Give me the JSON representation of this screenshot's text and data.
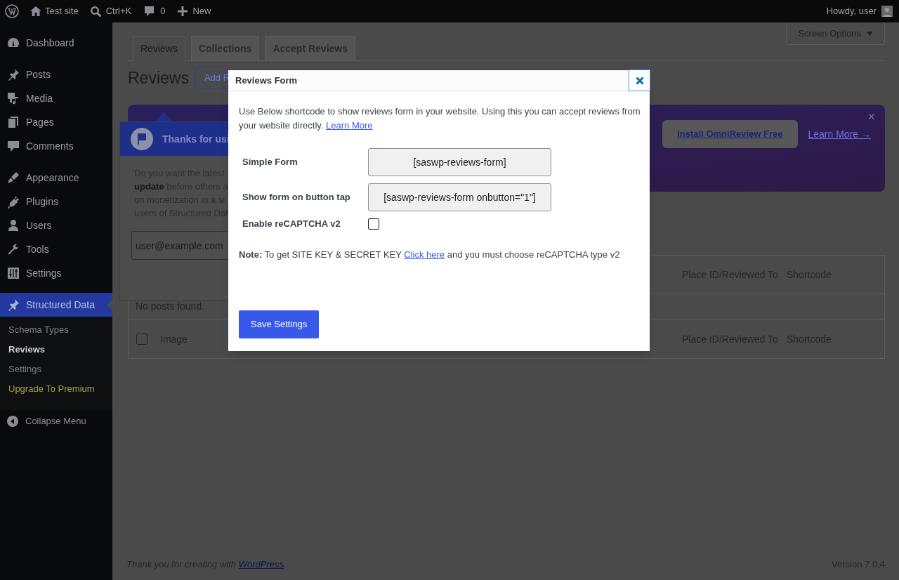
{
  "admin_bar": {
    "site": "Test site",
    "search": "Ctrl+K",
    "comments": "0",
    "new": "New",
    "greeting": "Howdy, user"
  },
  "sidebar": {
    "groups": [
      [
        {
          "label": "Dashboard",
          "selected": false
        }
      ],
      [
        {
          "label": "Posts",
          "selected": false
        },
        {
          "label": "Media",
          "selected": false
        },
        {
          "label": "Pages",
          "selected": false
        },
        {
          "label": "Comments",
          "selected": false
        }
      ],
      [
        {
          "label": "Appearance",
          "selected": false
        },
        {
          "label": "Plugins",
          "selected": false
        },
        {
          "label": "Users",
          "selected": false
        },
        {
          "label": "Tools",
          "selected": false
        },
        {
          "label": "Settings",
          "selected": false
        }
      ],
      [
        {
          "label": "Structured Data",
          "selected": true
        }
      ]
    ],
    "submenu": [
      {
        "label": "Schema Types",
        "kind": "link",
        "selected": false
      },
      {
        "label": "Reviews",
        "kind": "link",
        "selected": true
      },
      {
        "label": "Settings",
        "kind": "link",
        "selected": false
      },
      {
        "label": "Upgrade To Premium",
        "kind": "upgrade",
        "selected": false
      }
    ],
    "collapse": "Collapse Menu"
  },
  "screen_options": "Screen Options",
  "tabs": [
    {
      "label": "Reviews",
      "selected": true
    },
    {
      "label": "Collections",
      "selected": false
    },
    {
      "label": "Accept Reviews",
      "selected": false
    }
  ],
  "heading": "Reviews",
  "add_button": "Add R",
  "promo": {
    "button": "Install OmniReview Free",
    "link": "Learn More →",
    "close": "×"
  },
  "tooltip": {
    "title": "Thanks for usi",
    "text": "Do you want the latest\n**update** before others a\non monetization in a si\nusers of Structured Dat",
    "email": "user@example.com"
  },
  "table": {
    "header": [
      "Place ID/Reviewed To",
      "Shortcode"
    ],
    "empty": "No posts found.",
    "footer": {
      "checked": false,
      "cells": [
        "Image",
        "Place ID/Reviewed To",
        "Shortcode"
      ]
    }
  },
  "footer": {
    "text": "Thank you for creating with",
    "link": "WordPress",
    "after": ".",
    "version": "Version 7.0.4"
  },
  "modal": {
    "title": "Reviews Form",
    "description": "Use Below shortcode to show reviews form in your website. Using this you can accept reviews from your website directly.",
    "learn_more": "Learn More",
    "fields": [
      {
        "label": "Simple Form",
        "kind": "shortcode",
        "value": "[saswp-reviews-form]"
      },
      {
        "label": "Show form on button tap",
        "kind": "shortcode",
        "value": "[saswp-reviews-form onbutton=\"1\"]"
      },
      {
        "label": "Enable reCAPTCHA v2",
        "kind": "checkbox",
        "checked": false
      }
    ],
    "note": "**Note:** To get SITE KEY & SECRET KEY",
    "note_link": "Click here",
    "note_after": "and you must choose reCAPTCHA type v2",
    "save": "Save Settings"
  }
}
